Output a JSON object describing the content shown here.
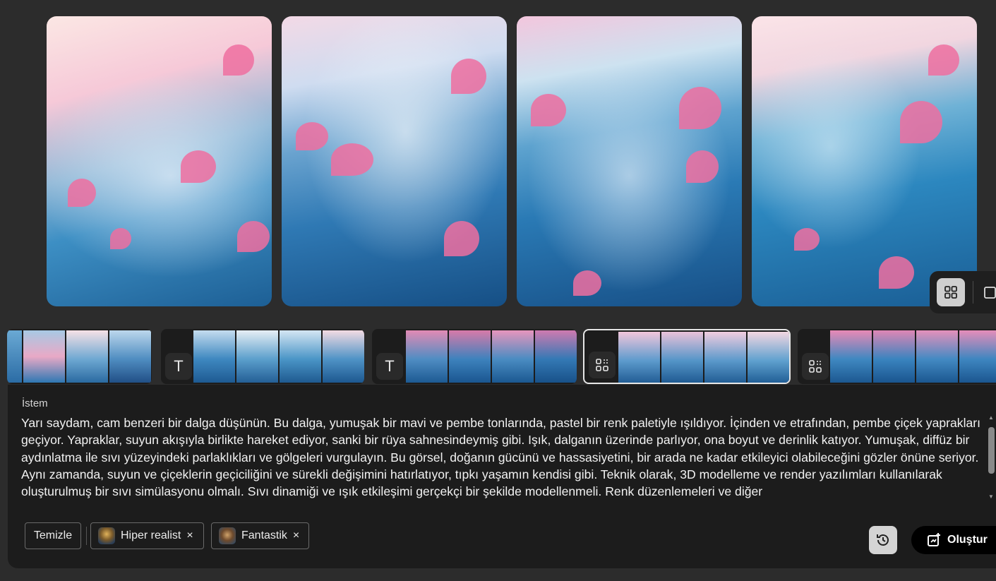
{
  "gallery": {
    "images": [
      {
        "alt_icon": "wave-image"
      },
      {
        "alt_icon": "wave-image"
      },
      {
        "alt_icon": "wave-image"
      },
      {
        "alt_icon": "wave-image"
      }
    ]
  },
  "view_toggle": {
    "grid_icon": "grid-icon",
    "single_icon": "square-icon"
  },
  "history_strip": {
    "groups": [
      {
        "type_icon": "none"
      },
      {
        "type_icon": "text-icon",
        "glyph": "T"
      },
      {
        "type_icon": "text-icon",
        "glyph": "T"
      },
      {
        "type_icon": "style-icon"
      },
      {
        "type_icon": "style-icon"
      }
    ]
  },
  "prompt": {
    "label": "İstem",
    "text": "Yarı saydam, cam benzeri bir dalga düşünün. Bu dalga, yumuşak bir mavi ve pembe tonlarında, pastel bir renk paletiyle ışıldıyor. İçinden ve etrafından, pembe çiçek yaprakları geçiyor. Yapraklar, suyun akışıyla birlikte hareket ediyor, sanki bir rüya sahnesindeymiş gibi. Işık, dalganın üzerinde parlıyor, ona boyut ve derinlik katıyor. Yumuşak, diffüz bir aydınlatma ile sıvı yüzeyindeki parlaklıkları ve gölgeleri vurgulayın. Bu görsel, doğanın gücünü ve hassasiyetini, bir arada ne kadar etkileyici olabileceğini gözler önüne seriyor. Aynı zamanda, suyun ve çiçeklerin geçiciliğini ve sürekli değişimini hatırlatıyor, tıpkı yaşamın kendisi gibi. Teknik olarak, 3D modelleme ve render yazılımları kullanılarak oluşturulmuş bir sıvı simülasyonu olmalı. Sıvı dinamiği ve ışık etkileşimi gerçekçi bir şekilde modellenmeli. Renk düzenlemeleri ve diğer"
  },
  "controls": {
    "clear_label": "Temizle",
    "tags": [
      {
        "label": "Hiper realist",
        "remove": "×"
      },
      {
        "label": "Fantastik",
        "remove": "×"
      }
    ],
    "history_icon": "history-icon",
    "generate_label": "Oluştur",
    "generate_icon": "generate-icon"
  },
  "colors": {
    "background": "#2c2c2c",
    "panel": "#1c1c1c",
    "water": "#2e7fb8",
    "petal": "#ef6fa0"
  }
}
